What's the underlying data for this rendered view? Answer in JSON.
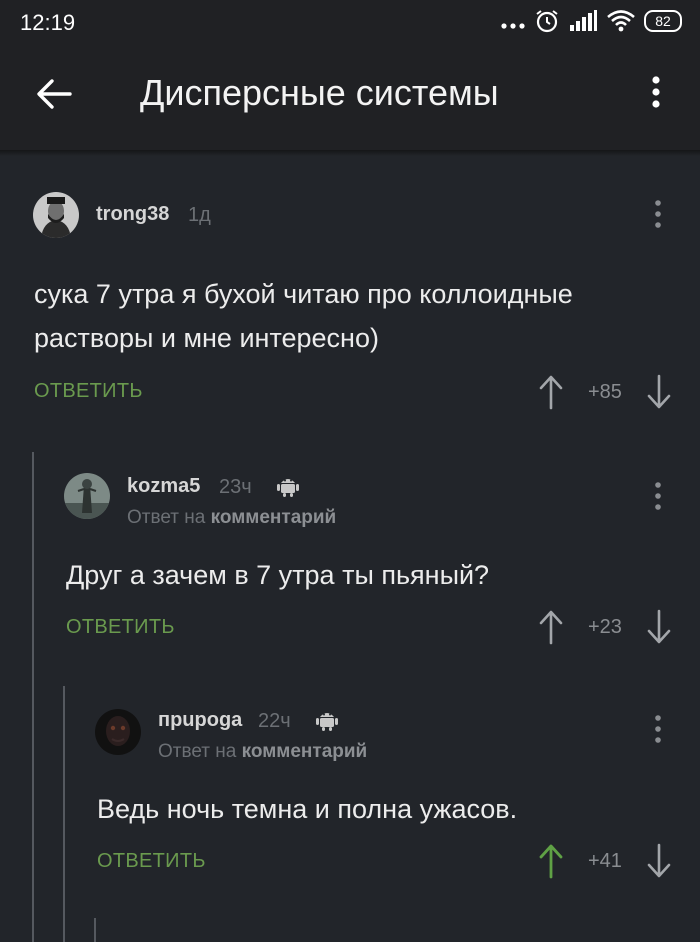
{
  "statusbar": {
    "time": "12:19",
    "battery": "82"
  },
  "appbar": {
    "title": "Дисперсные системы"
  },
  "comments": [
    {
      "username": "trong38",
      "time": "1д",
      "text": "сука 7 утра я бухой читаю про коллоидные растворы  и мне интересно)",
      "reply_label": "ОТВЕТИТЬ",
      "score": "+85"
    },
    {
      "username": "kozma5",
      "time": "23ч",
      "reply_to_prefix": "Ответ на",
      "reply_to_target": "комментарий",
      "text": "Друг а зачем в 7 утра ты пьяный?",
      "reply_label": "ОТВЕТИТЬ",
      "score": "+23"
    },
    {
      "username": "прupoga",
      "time": "22ч",
      "reply_to_prefix": "Ответ на",
      "reply_to_target": "комментарий",
      "text": "Ведь ночь темна и полна ужасов.",
      "reply_label": "ОТВЕТИТЬ",
      "score": "+41"
    }
  ],
  "colors": {
    "background": "#22252a",
    "reply_green": "#6a9a4e",
    "upvoted_green": "#5fa145"
  }
}
